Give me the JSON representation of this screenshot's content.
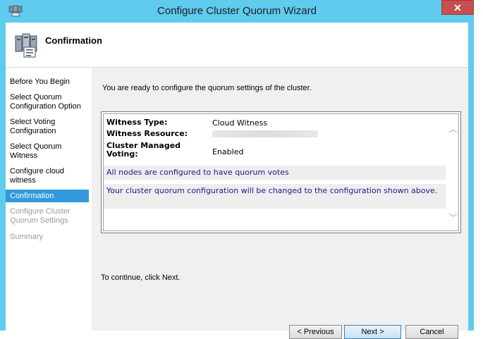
{
  "window": {
    "title": "Configure Cluster Quorum Wizard",
    "close_glyph": "✕"
  },
  "header": {
    "title": "Confirmation"
  },
  "nav": {
    "items": [
      {
        "label": "Before You Begin",
        "state": "normal"
      },
      {
        "label": "Select Quorum Configuration Option",
        "state": "normal"
      },
      {
        "label": "Select Voting Configuration",
        "state": "normal"
      },
      {
        "label": "Select Quorum Witness",
        "state": "normal"
      },
      {
        "label": "Configure cloud witness",
        "state": "normal"
      },
      {
        "label": "Confirmation",
        "state": "selected"
      },
      {
        "label": "Configure Cluster Quorum Settings",
        "state": "disabled"
      },
      {
        "label": "Summary",
        "state": "disabled"
      }
    ]
  },
  "main": {
    "intro": "You are ready to configure the quorum settings of the cluster.",
    "summary": {
      "witness_type_label": "Witness Type:",
      "witness_type_value": "Cloud Witness",
      "witness_resource_label": "Witness Resource:",
      "managed_voting_label": "Cluster Managed Voting:",
      "managed_voting_value": "Enabled",
      "note1": "All nodes are configured to have quorum votes",
      "note2": "Your cluster quorum configuration will be changed to the configuration shown above."
    },
    "continue_text": "To continue, click Next."
  },
  "buttons": {
    "previous": "< Previous",
    "next": "Next >",
    "cancel": "Cancel"
  },
  "colors": {
    "title_bar": "#5fcbee",
    "nav_selected": "#3399dd",
    "close": "#c74f4f",
    "note_text": "#1a1a8a"
  },
  "icons": {
    "title": "cluster-manager-icon",
    "header": "server-cluster-icon"
  }
}
